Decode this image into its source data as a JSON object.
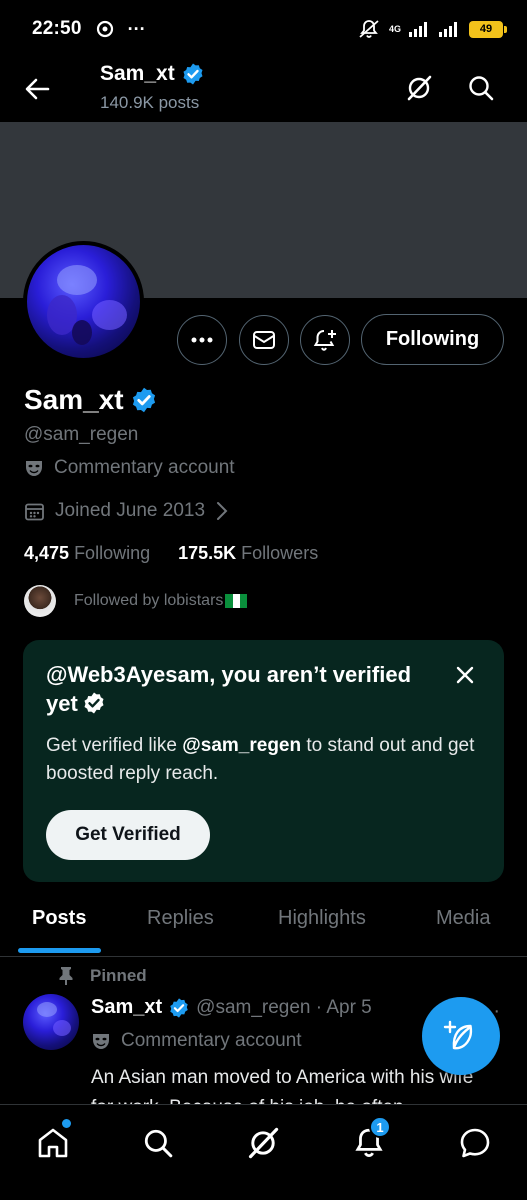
{
  "status_bar": {
    "time": "22:50",
    "more": "···",
    "network": "4G",
    "battery": "49"
  },
  "top_nav": {
    "title": "Sam_xt",
    "posts_count": "140.9K posts"
  },
  "profile": {
    "display_name": "Sam_xt",
    "handle": "@sam_regen",
    "category": "Commentary account",
    "joined": "Joined June 2013",
    "following_count": "4,475",
    "following_label": "Following",
    "followers_count": "175.5K",
    "followers_label": "Followers",
    "followed_by": "Followed by lobistars"
  },
  "actions": {
    "following_button": "Following"
  },
  "verify_card": {
    "title": "@Web3Ayesam, you aren’t verified yet",
    "desc_prefix": "Get verified like ",
    "desc_handle": "@sam_regen",
    "desc_suffix": " to stand out and get boosted reply reach.",
    "button": "Get Verified"
  },
  "tabs": [
    {
      "label": "Posts",
      "active": true
    },
    {
      "label": "Replies",
      "active": false
    },
    {
      "label": "Highlights",
      "active": false
    },
    {
      "label": "Media",
      "active": false
    }
  ],
  "post": {
    "pinned_label": "Pinned",
    "author": "Sam_xt",
    "handle_date": "@sam_regen · Apr 5",
    "more": "···",
    "category": "Commentary account",
    "text": "An Asian man moved to America with his wife for work. Because of his job, he often"
  },
  "bottom_nav": {
    "notification_count": "1"
  },
  "colors": {
    "accent": "#1d9bf0",
    "background": "#000000",
    "banner": "#33373c",
    "verify_card_bg": "#07261f",
    "muted_text": "#71767b"
  },
  "icons": [
    "back-arrow-icon",
    "grok-icon",
    "search-icon",
    "more-icon",
    "mail-icon",
    "bell-plus-icon",
    "verified-badge-icon",
    "theater-mask-icon",
    "calendar-icon",
    "chevron-right-icon",
    "close-icon",
    "pin-icon",
    "compose-icon",
    "home-icon",
    "bell-icon",
    "chat-icon"
  ]
}
